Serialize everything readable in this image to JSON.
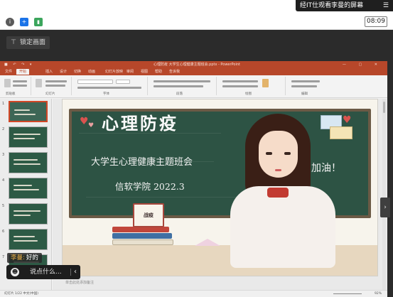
{
  "top_notice": {
    "text": "经IT仕观看李曼的屏幕",
    "menu_icon": "menu-icon"
  },
  "status": {
    "icons": [
      "info-icon",
      "shield-plus-icon",
      "signal-icon"
    ],
    "time": "08:09"
  },
  "pin_bar": {
    "label": "锁定画面"
  },
  "ppt": {
    "window_title": "心理防疫 大学生心理健康主题班会.pptx - PowerPoint",
    "tabs": [
      "文件",
      "开始",
      "插入",
      "设计",
      "切换",
      "动画",
      "幻灯片放映",
      "审阅",
      "视图",
      "帮助",
      "告诉我"
    ],
    "ribbon_groups": [
      "剪贴板",
      "幻灯片",
      "字体",
      "段落",
      "绘图",
      "编辑"
    ],
    "slide": {
      "title": "心理防疫",
      "subtitle": "大学生心理健康主题班会",
      "org_line": "信软学院  2022.3",
      "side_text": "加油！",
      "card_text": "战疫"
    },
    "notes_placeholder": "单击此处添加备注",
    "statusbar_left": "幻灯片 1/22   中文(中国)",
    "statusbar_right": "92%"
  },
  "chat": {
    "last_message_sender": "李曼:",
    "last_message_text": "好的",
    "input_placeholder": "说点什么..."
  },
  "colors": {
    "ppt_accent": "#b7472a",
    "board_green": "#2d5344",
    "meeting_dark": "#2b2b2b"
  }
}
